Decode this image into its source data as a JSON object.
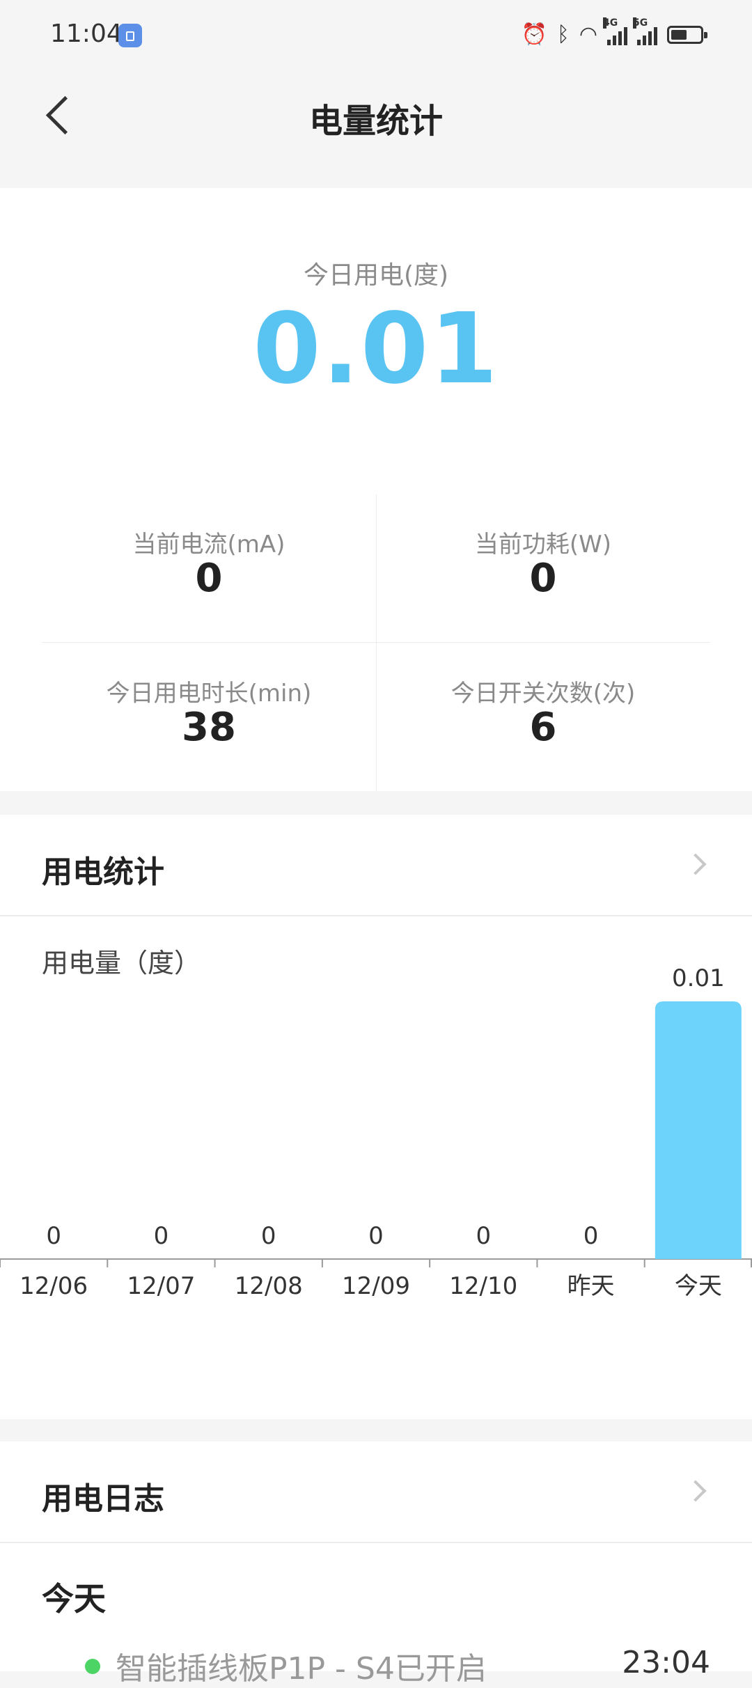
{
  "status": {
    "time": "11:04",
    "net1": "4G",
    "net2": "5G"
  },
  "nav": {
    "title": "电量统计"
  },
  "today": {
    "label": "今日用电(度)",
    "value": "0.01"
  },
  "metrics": [
    {
      "label": "当前电流(mA)",
      "value": "0"
    },
    {
      "label": "当前功耗(W)",
      "value": "0"
    },
    {
      "label": "今日用电时长(min)",
      "value": "38"
    },
    {
      "label": "今日开关次数(次)",
      "value": "6"
    }
  ],
  "usage_section": {
    "title": "用电统计",
    "ylabel": "用电量（度）"
  },
  "chart_data": {
    "type": "bar",
    "categories": [
      "12/06",
      "12/07",
      "12/08",
      "12/09",
      "12/10",
      "昨天",
      "今天"
    ],
    "values": [
      0,
      0,
      0,
      0,
      0,
      0,
      0.01
    ],
    "value_labels": [
      "0",
      "0",
      "0",
      "0",
      "0",
      "0",
      "0.01"
    ],
    "ylabel": "用电量（度）",
    "ylim": [
      0,
      0.01
    ],
    "grid": false,
    "bar_color": "#6ed3fb"
  },
  "log_section": {
    "title": "用电日志",
    "group": "今天",
    "entries": [
      {
        "text": "智能插线板P1P - S4已开启",
        "time": "23:04"
      }
    ]
  },
  "colors": {
    "accent": "#59c3f2",
    "bar": "#6ed3fb",
    "status_on": "#4cd464"
  },
  "icons": [
    "back-icon",
    "chevron-right-icon",
    "alarm-icon",
    "bluetooth-icon",
    "wifi-icon",
    "battery-icon"
  ]
}
